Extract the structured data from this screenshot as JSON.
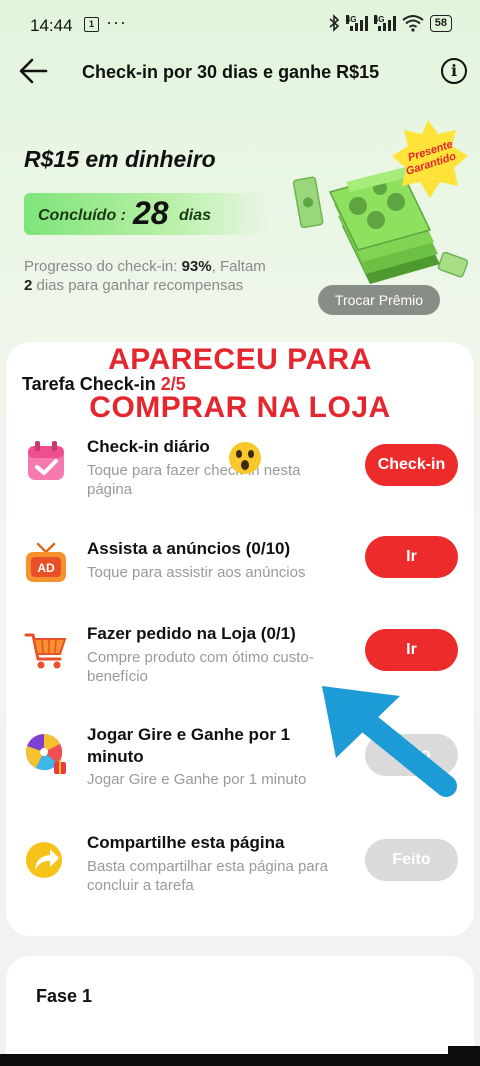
{
  "status_bar": {
    "time": "14:44",
    "notif_label": "1",
    "dots": "···",
    "sig1_label": "4G",
    "sig2_label": "4G",
    "battery": "58"
  },
  "nav": {
    "title": "Check-in por 30 dias e ganhe R$15"
  },
  "reward": {
    "title": "R$15 em dinheiro",
    "done_label": "Concluído :",
    "done_days": "28",
    "done_unit": "dias",
    "progress_prefix": "Progresso do check-in: ",
    "progress_value": "93%",
    "progress_mid": ", Faltam ",
    "days_left": "2",
    "progress_suffix": " dias para ganhar recompensas",
    "badge_line1": "Presente",
    "badge_line2": "Garantido",
    "swap_label": "Trocar Prêmio"
  },
  "overlay": {
    "line1": "APARECEU PARA",
    "line2": "COMPRAR NA LOJA"
  },
  "tasks": {
    "header": "Tarefa Check-in",
    "header_count": "2/5",
    "items": [
      {
        "name": "Check-in diário",
        "desc": "Toque para fazer check-in nesta página",
        "button": "Check-in",
        "state": "active",
        "icon": "calendar-icon"
      },
      {
        "name": "Assista a anúncios  (0/10)",
        "desc": "Toque para assistir aos anúncios",
        "button": "Ir",
        "state": "active",
        "icon": "tv-ad-icon"
      },
      {
        "name": "Fazer pedido na Loja  (0/1)",
        "desc": "Compre produto com ótimo custo-benefício",
        "button": "Ir",
        "state": "active",
        "icon": "shopping-cart-icon"
      },
      {
        "name": "Jogar Gire e Ganhe por 1 minuto",
        "desc": "Jogar Gire e Ganhe por 1 minuto",
        "button": "Feito",
        "state": "done",
        "icon": "prize-wheel-icon"
      },
      {
        "name": "Compartilhe esta página",
        "desc": "Basta compartilhar esta página para concluir a tarefa",
        "button": "Feito",
        "state": "done",
        "icon": "share-arrow-icon"
      }
    ]
  },
  "phase": {
    "title": "Fase 1"
  },
  "colors": {
    "accent_red": "#ed2b2b",
    "success_green": "#7ee47a",
    "annotation_blue": "#1d9bd6"
  }
}
